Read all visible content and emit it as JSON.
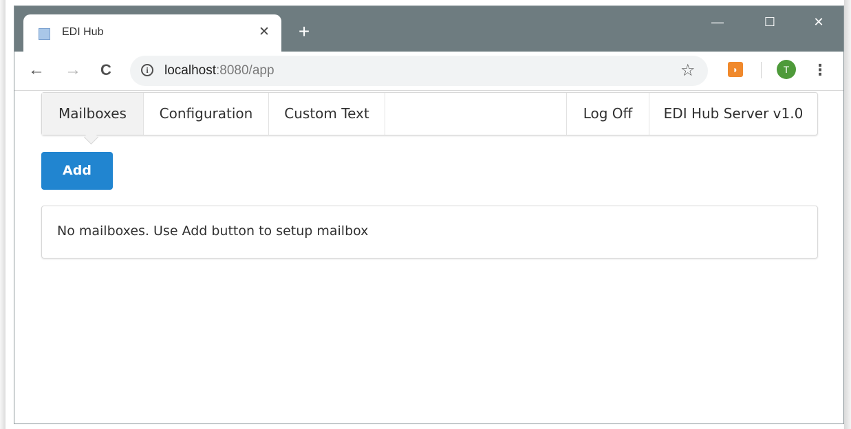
{
  "browser": {
    "tab_title": "EDI Hub",
    "tab_close": "✕",
    "new_tab": "+",
    "minimize": "—",
    "maximize": "☐",
    "close": "✕",
    "url_host": "localhost",
    "url_rest": ":8080/app",
    "avatar_initial": "T",
    "icons": {
      "back": "←",
      "forward": "→",
      "reload": "C",
      "info": "i",
      "star": "☆",
      "rss": "◗",
      "menu": "⋮"
    }
  },
  "app": {
    "menu": {
      "items": [
        "Mailboxes",
        "Configuration",
        "Custom Text"
      ],
      "right_items": [
        "Log Off",
        "EDI Hub Server v1.0"
      ]
    },
    "add_label": "Add",
    "empty_message": "No mailboxes. Use Add button to setup mailbox"
  },
  "colors": {
    "titlebar": "#6e7c80",
    "primary": "#2185d0",
    "avatar": "#4e9a3a",
    "rss": "#f0892c"
  }
}
